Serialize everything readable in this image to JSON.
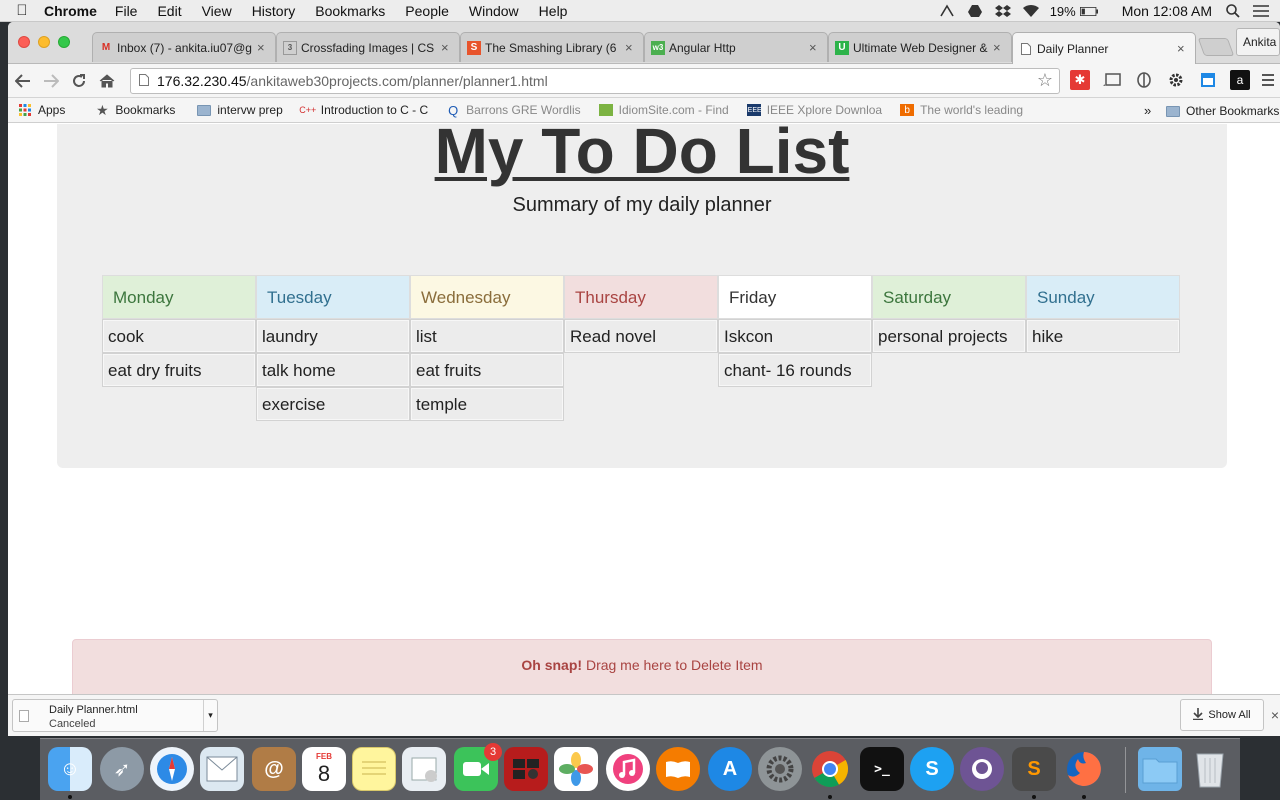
{
  "menubar": {
    "app_name": "Chrome",
    "menus": [
      "File",
      "Edit",
      "View",
      "History",
      "Bookmarks",
      "People",
      "Window",
      "Help"
    ],
    "battery": "19%",
    "clock": "Mon 12:08 AM"
  },
  "tabs": [
    {
      "title": "Inbox (7) - ankita.iu07@g",
      "icon": "gmail-icon",
      "color": "#d93025",
      "active": false
    },
    {
      "title": "Crossfading Images | CS",
      "icon": "css3-icon",
      "color": "#555555",
      "active": false
    },
    {
      "title": "The Smashing Library (6",
      "icon": "smashing-icon",
      "color": "#e8542c",
      "active": false
    },
    {
      "title": "Angular Http",
      "icon": "w3-icon",
      "color": "#4caf50",
      "active": false
    },
    {
      "title": "Ultimate Web Designer &",
      "icon": "udemy-icon",
      "color": "#2db34a",
      "active": false
    },
    {
      "title": "Daily Planner",
      "icon": "page-icon",
      "color": "#777777",
      "active": true
    }
  ],
  "profile_name": "Ankita",
  "address_bar": {
    "host": "176.32.230.45",
    "path": "/ankitaweb30projects.com/planner/planner1.html"
  },
  "bookmarks": [
    {
      "label": "Apps",
      "icon": "apps-grid-icon"
    },
    {
      "label": "Bookmarks",
      "icon": "star-icon"
    },
    {
      "label": "intervw prep",
      "icon": "folder-icon"
    },
    {
      "label": "Introduction to C - C",
      "icon": "cpp-icon"
    },
    {
      "label": "Barrons GRE Wordlis",
      "icon": "q-icon"
    },
    {
      "label": "IdiomSite.com - Find",
      "icon": "idiom-icon"
    },
    {
      "label": "IEEE Xplore Downloa",
      "icon": "ieee-icon"
    },
    {
      "label": "The world's leading ",
      "icon": "b-icon"
    }
  ],
  "bookmarks_overflow": "»",
  "other_bookmarks": "Other Bookmarks",
  "page": {
    "title": "My To Do List",
    "subtitle": "Summary of my daily planner",
    "days": [
      {
        "name": "Monday",
        "bg": "#dff0d8",
        "color": "#3c763d",
        "items": [
          "cook",
          "eat dry fruits"
        ]
      },
      {
        "name": "Tuesday",
        "bg": "#d9edf7",
        "color": "#31708f",
        "items": [
          "laundry",
          "talk home",
          "exercise"
        ]
      },
      {
        "name": "Wednesday",
        "bg": "#fcf8e3",
        "color": "#8a6d3b",
        "items": [
          "list",
          "eat fruits",
          "temple"
        ]
      },
      {
        "name": "Thursday",
        "bg": "#f2dede",
        "color": "#a94442",
        "items": [
          "Read novel"
        ]
      },
      {
        "name": "Friday",
        "bg": "#ffffff",
        "color": "#333333",
        "items": [
          "Iskcon",
          "chant- 16 rounds"
        ]
      },
      {
        "name": "Saturday",
        "bg": "#dff0d8",
        "color": "#3c763d",
        "items": [
          "personal projects"
        ]
      },
      {
        "name": "Sunday",
        "bg": "#d9edf7",
        "color": "#31708f",
        "items": [
          "hike"
        ]
      }
    ],
    "delete_zone": {
      "strong": "Oh snap!",
      "text": " Drag me here to Delete Item"
    }
  },
  "download": {
    "filename": "Daily Planner.html",
    "status": "Canceled",
    "show_all": "Show All"
  },
  "dock": {
    "calendar_month": "FEB",
    "calendar_day": "8",
    "facetime_badge": "3"
  }
}
